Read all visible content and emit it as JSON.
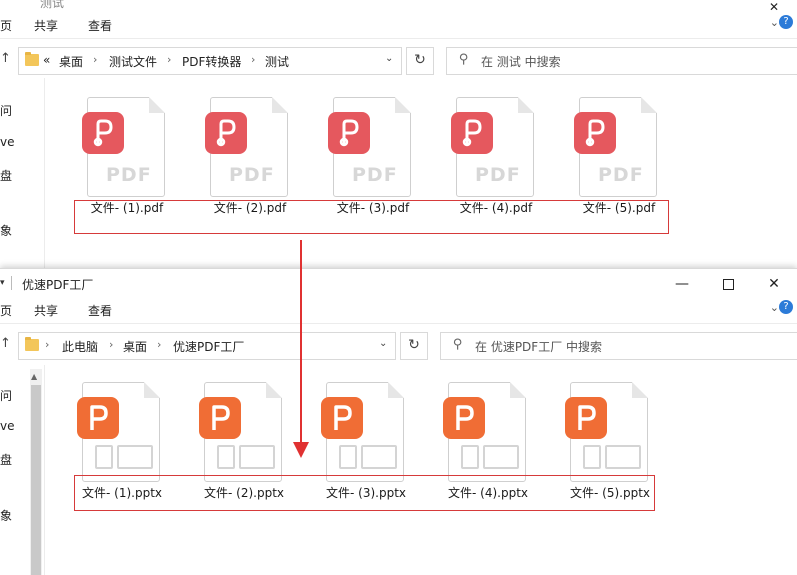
{
  "colors": {
    "pdf_badge": "#e5585e",
    "pptx_badge": "#f06d35",
    "highlight_box": "#d63a3a",
    "arrow": "#e03131"
  },
  "window1": {
    "title": "测试",
    "ribbon": {
      "tab_file": "页",
      "tab_share": "共享",
      "tab_view": "查看"
    },
    "address": {
      "overflow": "«",
      "crumbs": [
        "桌面",
        "测试文件",
        "PDF转换器",
        "测试"
      ]
    },
    "search_placeholder": "在 测试 中搜索",
    "nav": [
      "问",
      "ve",
      "盘",
      "象"
    ],
    "files": [
      {
        "name": "文件- (1).pdf",
        "icon": "pdf-icon"
      },
      {
        "name": "文件- (2).pdf",
        "icon": "pdf-icon"
      },
      {
        "name": "文件- (3).pdf",
        "icon": "pdf-icon"
      },
      {
        "name": "文件- (4).pdf",
        "icon": "pdf-icon"
      },
      {
        "name": "文件- (5).pdf",
        "icon": "pdf-icon"
      }
    ],
    "file_label": "PDF"
  },
  "window2": {
    "title": "优速PDF工厂",
    "ribbon": {
      "tab_file": "页",
      "tab_share": "共享",
      "tab_view": "查看"
    },
    "address": {
      "crumbs": [
        "此电脑",
        "桌面",
        "优速PDF工厂"
      ]
    },
    "search_placeholder": "在 优速PDF工厂 中搜索",
    "nav": [
      "问",
      "ve",
      "盘",
      "象"
    ],
    "files": [
      {
        "name": "文件- (1).pptx",
        "icon": "pptx-icon"
      },
      {
        "name": "文件- (2).pptx",
        "icon": "pptx-icon"
      },
      {
        "name": "文件- (3).pptx",
        "icon": "pptx-icon"
      },
      {
        "name": "文件- (4).pptx",
        "icon": "pptx-icon"
      },
      {
        "name": "文件- (5).pptx",
        "icon": "pptx-icon"
      }
    ]
  }
}
